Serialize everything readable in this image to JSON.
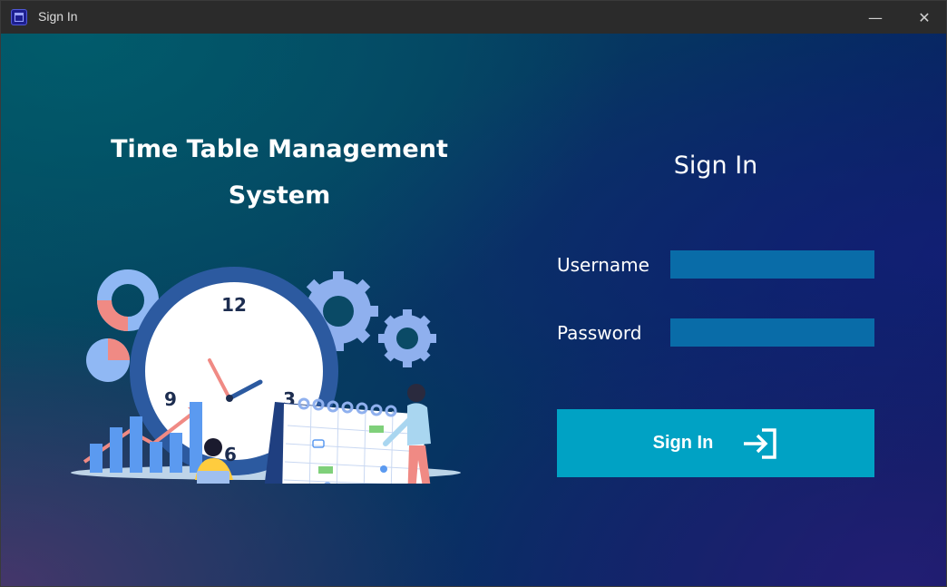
{
  "window": {
    "title": "Sign In",
    "icon": "calendar-app-icon",
    "controls": {
      "minimize_icon": "minimize-icon",
      "close_icon": "close-icon",
      "minimize_glyph": "—",
      "close_glyph": "✕"
    }
  },
  "left_panel": {
    "heading_line1": "Time Table Management",
    "heading_line2": "System",
    "illustration": {
      "description_icon": "timetable-illustration",
      "clock_numbers": [
        "12",
        "3",
        "6",
        "9"
      ]
    }
  },
  "form": {
    "title": "Sign In",
    "username_label": "Username",
    "username_value": "",
    "password_label": "Password",
    "password_value": "",
    "submit_label": "Sign In",
    "submit_icon": "login-arrow-icon"
  },
  "colors": {
    "input_bg": "#096ca8",
    "button_bg": "#00a2c4",
    "titlebar_bg": "#2b2b2b"
  }
}
